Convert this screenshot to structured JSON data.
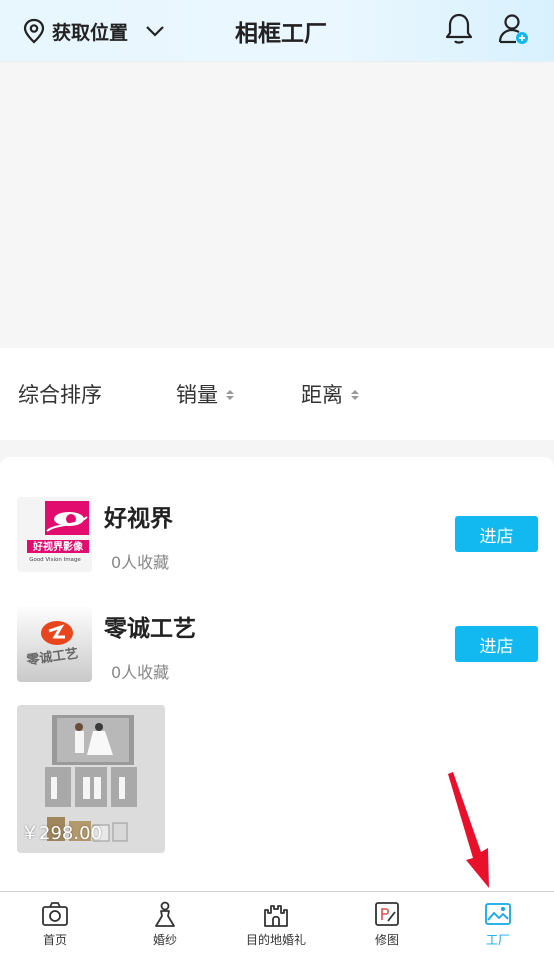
{
  "header": {
    "location_label": "获取位置",
    "title": "相框工厂",
    "icons": [
      "location-pin-icon",
      "chevron-down-icon",
      "bell-icon",
      "user-add-icon"
    ]
  },
  "sort_bar": {
    "items": [
      {
        "label": "综合排序",
        "sortable": false
      },
      {
        "label": "销量",
        "sortable": true
      },
      {
        "label": "距离",
        "sortable": true
      }
    ]
  },
  "shops": [
    {
      "name": "好视界",
      "favorites": "0人收藏",
      "button": "进店",
      "logo_text": "好视界影像",
      "logo_subtext": "Good Vision Image"
    },
    {
      "name": "零诚工艺",
      "favorites": "0人收藏",
      "button": "进店",
      "logo_text": "零诚工艺"
    }
  ],
  "product": {
    "price": "￥298.00"
  },
  "tabbar": {
    "tabs": [
      {
        "label": "首页",
        "icon": "camera-icon",
        "active": false
      },
      {
        "label": "婚纱",
        "icon": "bride-icon",
        "active": false
      },
      {
        "label": "目的地婚礼",
        "icon": "castle-icon",
        "active": false
      },
      {
        "label": "修图",
        "icon": "photo-edit-icon",
        "active": false
      },
      {
        "label": "工厂",
        "icon": "picture-icon",
        "active": true
      }
    ]
  },
  "colors": {
    "accent": "#12b9f0",
    "active_tab": "#12a8e8",
    "annotation_arrow": "#e8102a"
  }
}
